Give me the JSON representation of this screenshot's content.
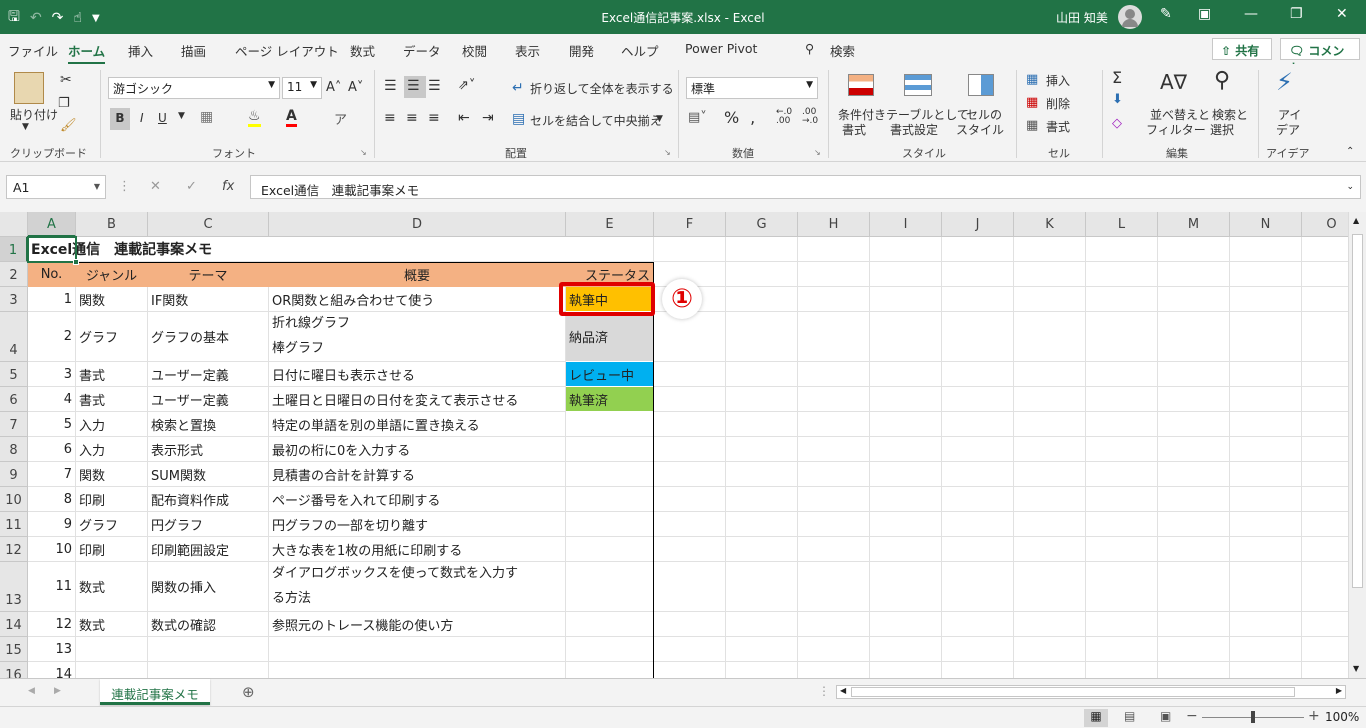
{
  "titlebar": {
    "title": "Excel通信記事案.xlsx  -  Excel",
    "user": "山田 知美"
  },
  "menu": {
    "tabs": [
      "ファイル",
      "ホーム",
      "挿入",
      "描画",
      "ページ レイアウト",
      "数式",
      "データ",
      "校閲",
      "表示",
      "開発",
      "ヘルプ",
      "Power Pivot"
    ],
    "search": "検索",
    "share": "共有",
    "comment": "コメント"
  },
  "ribbon": {
    "paste": "貼り付け",
    "font_name": "游ゴシック",
    "font_size": "11",
    "wrap_text": "折り返して全体を表示する",
    "merge_center": "セルを結合して中央揃え",
    "number_format": "標準",
    "conditional_1": "条件付き",
    "conditional_2": "書式",
    "table_1": "テーブルとして",
    "table_2": "書式設定",
    "cellstyle_1": "セルの",
    "cellstyle_2": "スタイル",
    "insert": "挿入",
    "delete": "削除",
    "format": "書式",
    "sort_1": "並べ替えと",
    "sort_2": "フィルター",
    "find_1": "検索と",
    "find_2": "選択",
    "ideas_1": "アイ",
    "ideas_2": "デア",
    "groups": {
      "clipboard": "クリップボード",
      "font": "フォント",
      "alignment": "配置",
      "number": "数値",
      "style": "スタイル",
      "cells": "セル",
      "editing": "編集",
      "ideas": "アイデア"
    }
  },
  "formula": {
    "name_box": "A1",
    "fx": "fx",
    "content": "Excel通信　連載記事案メモ"
  },
  "grid": {
    "columns": [
      "A",
      "B",
      "C",
      "D",
      "E",
      "F",
      "G",
      "H",
      "I",
      "J",
      "K",
      "L",
      "M",
      "N",
      "O"
    ],
    "rows": [
      "1",
      "2",
      "3",
      "4",
      "5",
      "6",
      "7",
      "8",
      "9",
      "10",
      "11",
      "12",
      "13",
      "14",
      "15",
      "16"
    ],
    "title": "Excel通信　連載記事案メモ",
    "header": {
      "no": "No.",
      "genre": "ジャンル",
      "theme": "テーマ",
      "summary": "概要",
      "status": "ステータス"
    },
    "records": [
      {
        "no": "1",
        "genre": "関数",
        "theme": "IF関数",
        "summary": "OR関数と組み合わせて使う",
        "status": "執筆中"
      },
      {
        "no": "2",
        "genre": "グラフ",
        "theme": "グラフの基本",
        "summary_1": "折れ線グラフ",
        "summary_2": "棒グラフ",
        "status": "納品済"
      },
      {
        "no": "3",
        "genre": "書式",
        "theme": "ユーザー定義",
        "summary": "日付に曜日も表示させる",
        "status": "レビュー中"
      },
      {
        "no": "4",
        "genre": "書式",
        "theme": "ユーザー定義",
        "summary": "土曜日と日曜日の日付を変えて表示させる",
        "status": "執筆済"
      },
      {
        "no": "5",
        "genre": "入力",
        "theme": "検索と置換",
        "summary": "特定の単語を別の単語に置き換える"
      },
      {
        "no": "6",
        "genre": "入力",
        "theme": "表示形式",
        "summary": "最初の桁に0を入力する"
      },
      {
        "no": "7",
        "genre": "関数",
        "theme": "SUM関数",
        "summary": "見積書の合計を計算する"
      },
      {
        "no": "8",
        "genre": "印刷",
        "theme": "配布資料作成",
        "summary": "ページ番号を入れて印刷する"
      },
      {
        "no": "9",
        "genre": "グラフ",
        "theme": "円グラフ",
        "summary": "円グラフの一部を切り離す"
      },
      {
        "no": "10",
        "genre": "印刷",
        "theme": "印刷範囲設定",
        "summary": "大きな表を1枚の用紙に印刷する"
      },
      {
        "no": "11",
        "genre": "数式",
        "theme": "関数の挿入",
        "summary_1": "ダイアログボックスを使って数式を入力す",
        "summary_2": "る方法"
      },
      {
        "no": "12",
        "genre": "数式",
        "theme": "数式の確認",
        "summary": "参照元のトレース機能の使い方"
      },
      {
        "no": "13"
      },
      {
        "no": "14"
      }
    ]
  },
  "annotation": {
    "marker": "①"
  },
  "status_colors": {
    "executing": "#ffc000",
    "delivered": "#d9d9d9",
    "review": "#00b0f0",
    "done": "#92d050",
    "highlight_border": "#e00000"
  },
  "sheet": {
    "tab": "連載記事案メモ"
  },
  "statusbar": {
    "zoom": "100%"
  }
}
